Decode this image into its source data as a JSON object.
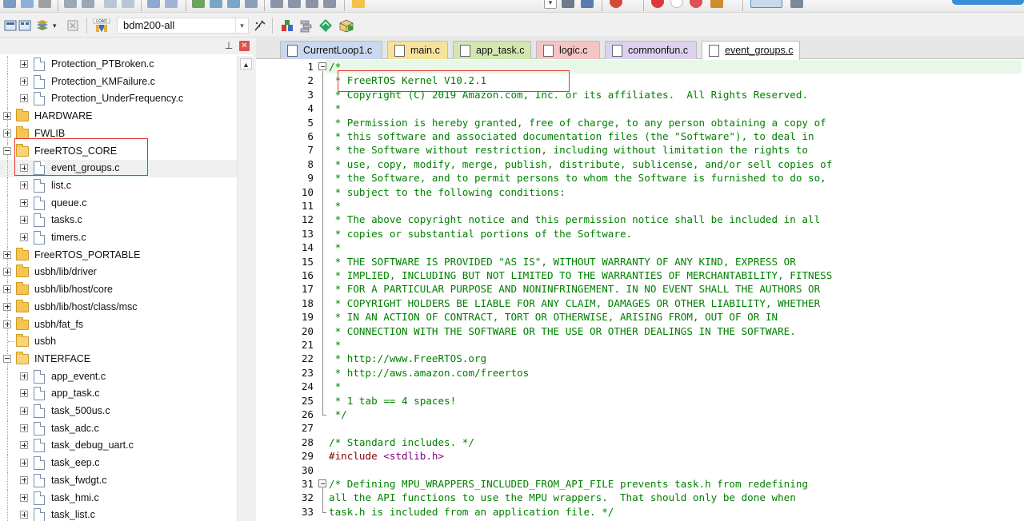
{
  "toolbar": {
    "target_name": "bdm200-all",
    "load_label": "LOAD"
  },
  "project": {
    "tree": [
      {
        "label": "Protection_PTBroken.c",
        "type": "file",
        "depth": 1
      },
      {
        "label": "Protection_KMFailure.c",
        "type": "file",
        "depth": 1
      },
      {
        "label": "Protection_UnderFrequency.c",
        "type": "file",
        "depth": 1
      },
      {
        "label": "HARDWARE",
        "type": "folder",
        "depth": 0,
        "expanded": false
      },
      {
        "label": "FWLIB",
        "type": "folder",
        "depth": 0,
        "expanded": false
      },
      {
        "label": "FreeRTOS_CORE",
        "type": "folder",
        "depth": 0,
        "expanded": true
      },
      {
        "label": "event_groups.c",
        "type": "file",
        "depth": 1,
        "selected": true
      },
      {
        "label": "list.c",
        "type": "file",
        "depth": 1
      },
      {
        "label": "queue.c",
        "type": "file",
        "depth": 1
      },
      {
        "label": "tasks.c",
        "type": "file",
        "depth": 1
      },
      {
        "label": "timers.c",
        "type": "file",
        "depth": 1
      },
      {
        "label": "FreeRTOS_PORTABLE",
        "type": "folder",
        "depth": 0,
        "expanded": false
      },
      {
        "label": "usbh/lib/driver",
        "type": "folder",
        "depth": 0,
        "expanded": false
      },
      {
        "label": "usbh/lib/host/core",
        "type": "folder",
        "depth": 0,
        "expanded": false
      },
      {
        "label": "usbh/lib/host/class/msc",
        "type": "folder",
        "depth": 0,
        "expanded": false
      },
      {
        "label": "usbh/fat_fs",
        "type": "folder",
        "depth": 0,
        "expanded": false
      },
      {
        "label": "usbh",
        "type": "folder",
        "depth": 0,
        "expanded": true,
        "empty": true
      },
      {
        "label": "INTERFACE",
        "type": "folder",
        "depth": 0,
        "expanded": true
      },
      {
        "label": "app_event.c",
        "type": "file",
        "depth": 1
      },
      {
        "label": "app_task.c",
        "type": "file",
        "depth": 1
      },
      {
        "label": "task_500us.c",
        "type": "file",
        "depth": 1
      },
      {
        "label": "task_adc.c",
        "type": "file",
        "depth": 1
      },
      {
        "label": "task_debug_uart.c",
        "type": "file",
        "depth": 1
      },
      {
        "label": "task_eep.c",
        "type": "file",
        "depth": 1
      },
      {
        "label": "task_fwdgt.c",
        "type": "file",
        "depth": 1
      },
      {
        "label": "task_hmi.c",
        "type": "file",
        "depth": 1
      },
      {
        "label": "task_list.c",
        "type": "file",
        "depth": 1
      }
    ]
  },
  "tabs": [
    {
      "label": "CurrentLoop1.c",
      "color": "#c9d7ef",
      "active": false
    },
    {
      "label": "main.c",
      "color": "#f7e29b",
      "active": false
    },
    {
      "label": "app_task.c",
      "color": "#d3e6b0",
      "active": false
    },
    {
      "label": "logic.c",
      "color": "#f3c5c5",
      "active": false
    },
    {
      "label": "commonfun.c",
      "color": "#dcd2ee",
      "active": false
    },
    {
      "label": "event_groups.c",
      "color": "#ffffff",
      "active": true
    }
  ],
  "code": {
    "lines": [
      {
        "n": "1",
        "text": "/*",
        "kind": "com"
      },
      {
        "n": "2",
        "text": " * FreeRTOS Kernel V10.2.1",
        "kind": "com"
      },
      {
        "n": "3",
        "text": " * Copyright (C) 2019 Amazon.com, Inc. or its affiliates.  All Rights Reserved.",
        "kind": "com"
      },
      {
        "n": "4",
        "text": " *",
        "kind": "com"
      },
      {
        "n": "5",
        "text": " * Permission is hereby granted, free of charge, to any person obtaining a copy of",
        "kind": "com"
      },
      {
        "n": "6",
        "text": " * this software and associated documentation files (the \"Software\"), to deal in",
        "kind": "com"
      },
      {
        "n": "7",
        "text": " * the Software without restriction, including without limitation the rights to",
        "kind": "com"
      },
      {
        "n": "8",
        "text": " * use, copy, modify, merge, publish, distribute, sublicense, and/or sell copies of",
        "kind": "com"
      },
      {
        "n": "9",
        "text": " * the Software, and to permit persons to whom the Software is furnished to do so,",
        "kind": "com"
      },
      {
        "n": "10",
        "text": " * subject to the following conditions:",
        "kind": "com"
      },
      {
        "n": "11",
        "text": " *",
        "kind": "com"
      },
      {
        "n": "12",
        "text": " * The above copyright notice and this permission notice shall be included in all",
        "kind": "com"
      },
      {
        "n": "13",
        "text": " * copies or substantial portions of the Software.",
        "kind": "com"
      },
      {
        "n": "14",
        "text": " *",
        "kind": "com"
      },
      {
        "n": "15",
        "text": " * THE SOFTWARE IS PROVIDED \"AS IS\", WITHOUT WARRANTY OF ANY KIND, EXPRESS OR",
        "kind": "com"
      },
      {
        "n": "16",
        "text": " * IMPLIED, INCLUDING BUT NOT LIMITED TO THE WARRANTIES OF MERCHANTABILITY, FITNESS",
        "kind": "com"
      },
      {
        "n": "17",
        "text": " * FOR A PARTICULAR PURPOSE AND NONINFRINGEMENT. IN NO EVENT SHALL THE AUTHORS OR",
        "kind": "com"
      },
      {
        "n": "18",
        "text": " * COPYRIGHT HOLDERS BE LIABLE FOR ANY CLAIM, DAMAGES OR OTHER LIABILITY, WHETHER",
        "kind": "com"
      },
      {
        "n": "19",
        "text": " * IN AN ACTION OF CONTRACT, TORT OR OTHERWISE, ARISING FROM, OUT OF OR IN",
        "kind": "com"
      },
      {
        "n": "20",
        "text": " * CONNECTION WITH THE SOFTWARE OR THE USE OR OTHER DEALINGS IN THE SOFTWARE.",
        "kind": "com"
      },
      {
        "n": "21",
        "text": " *",
        "kind": "com"
      },
      {
        "n": "22",
        "text": " * http://www.FreeRTOS.org",
        "kind": "com"
      },
      {
        "n": "23",
        "text": " * http://aws.amazon.com/freertos",
        "kind": "com"
      },
      {
        "n": "24",
        "text": " *",
        "kind": "com"
      },
      {
        "n": "25",
        "text": " * 1 tab == 4 spaces!",
        "kind": "com"
      },
      {
        "n": "26",
        "text": " */",
        "kind": "com"
      },
      {
        "n": "27",
        "text": "",
        "kind": "plain"
      },
      {
        "n": "28",
        "text": "/* Standard includes. */",
        "kind": "com"
      },
      {
        "n": "29",
        "text": "#include <stdlib.h>",
        "kind": "inc"
      },
      {
        "n": "30",
        "text": "",
        "kind": "plain"
      },
      {
        "n": "31",
        "text": "/* Defining MPU_WRAPPERS_INCLUDED_FROM_API_FILE prevents task.h from redefining",
        "kind": "com"
      },
      {
        "n": "32",
        "text": "all the API functions to use the MPU wrappers.  That should only be done when",
        "kind": "com"
      },
      {
        "n": "33",
        "text": "task.h is included from an application file. */",
        "kind": "com"
      }
    ]
  }
}
